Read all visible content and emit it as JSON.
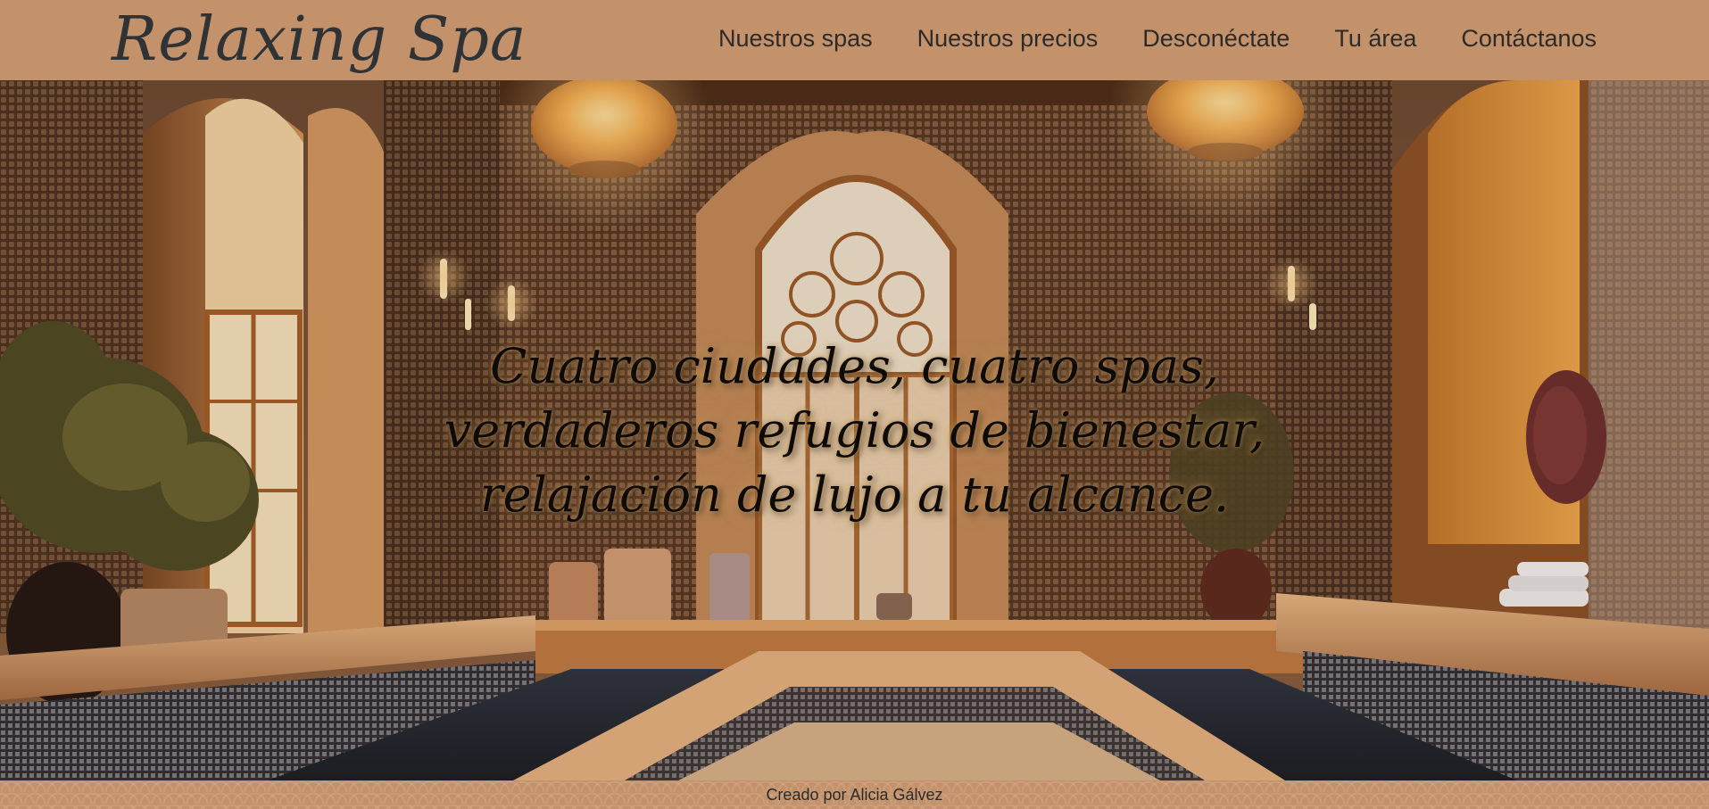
{
  "brand": {
    "logo_text": "Relaxing Spa"
  },
  "nav": {
    "items": [
      {
        "label": "Nuestros spas"
      },
      {
        "label": "Nuestros precios"
      },
      {
        "label": "Desconéctate"
      },
      {
        "label": "Tu área"
      },
      {
        "label": "Contáctanos"
      }
    ]
  },
  "hero": {
    "lines": [
      "Cuatro ciudades, cuatro spas,",
      "verdaderos refugios de bienestar,",
      "relajación de lujo a tu alcance."
    ],
    "image_subject": "moroccan-spa-interior"
  },
  "footer": {
    "credit": "Creado por Alicia Gálvez"
  },
  "colors": {
    "header_bg": "#c4926a",
    "footer_bg": "#c4926a",
    "text_dark": "#2f3336"
  }
}
